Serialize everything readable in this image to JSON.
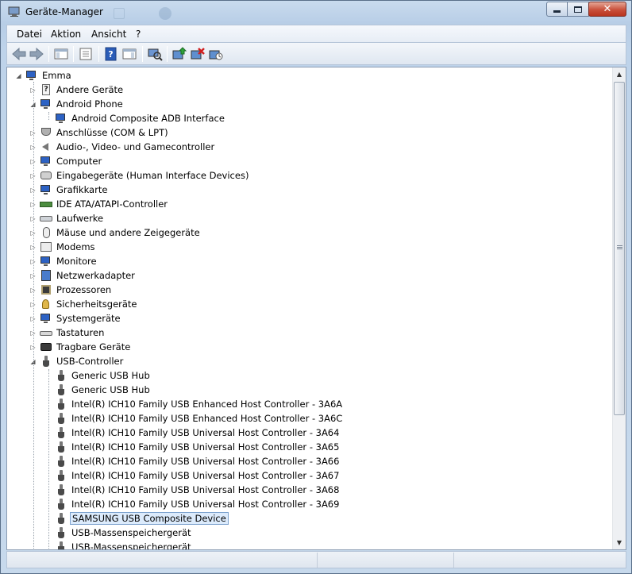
{
  "window": {
    "title": "Geräte-Manager",
    "controls": {
      "minimize": "minimize",
      "maximize": "maximize",
      "close": "✕"
    }
  },
  "menu": [
    "Datei",
    "Aktion",
    "Ansicht",
    "?"
  ],
  "toolbar": {
    "buttons": [
      "back-arrow-icon",
      "forward-arrow-icon",
      "show-hide-console-tree-icon",
      "properties-icon",
      "help-icon",
      "action-pane-icon",
      "scan-hardware-icon",
      "update-driver-icon",
      "uninstall-icon",
      "disable-device-icon"
    ]
  },
  "tree": {
    "root": {
      "label": "Emma",
      "expander": "◢"
    },
    "categories": [
      {
        "label": "Andere Geräte",
        "expander": "▷",
        "icon": "unknown-device-icon"
      },
      {
        "label": "Android Phone",
        "expander": "◢",
        "icon": "phone-icon"
      },
      {
        "label": "Android Composite ADB Interface",
        "icon": "adb-interface-icon"
      },
      {
        "label": "Anschlüsse (COM & LPT)",
        "expander": "▷",
        "icon": "port-icon"
      },
      {
        "label": "Audio-, Video- und Gamecontroller",
        "expander": "▷",
        "icon": "speaker-icon"
      },
      {
        "label": "Computer",
        "expander": "▷",
        "icon": "computer-icon"
      },
      {
        "label": "Eingabegeräte (Human Interface Devices)",
        "expander": "▷",
        "icon": "hid-icon"
      },
      {
        "label": "Grafikkarte",
        "expander": "▷",
        "icon": "display-adapter-icon"
      },
      {
        "label": "IDE ATA/ATAPI-Controller",
        "expander": "▷",
        "icon": "ide-controller-icon"
      },
      {
        "label": "Laufwerke",
        "expander": "▷",
        "icon": "disk-drive-icon"
      },
      {
        "label": "Mäuse und andere Zeigegeräte",
        "expander": "▷",
        "icon": "mouse-icon"
      },
      {
        "label": "Modems",
        "expander": "▷",
        "icon": "modem-icon"
      },
      {
        "label": "Monitore",
        "expander": "▷",
        "icon": "monitor-icon"
      },
      {
        "label": "Netzwerkadapter",
        "expander": "▷",
        "icon": "network-adapter-icon"
      },
      {
        "label": "Prozessoren",
        "expander": "▷",
        "icon": "processor-icon"
      },
      {
        "label": "Sicherheitsgeräte",
        "expander": "▷",
        "icon": "security-key-icon"
      },
      {
        "label": "Systemgeräte",
        "expander": "▷",
        "icon": "system-device-icon"
      },
      {
        "label": "Tastaturen",
        "expander": "▷",
        "icon": "keyboard-icon"
      },
      {
        "label": "Tragbare Geräte",
        "expander": "▷",
        "icon": "portable-device-icon"
      },
      {
        "label": "USB-Controller",
        "expander": "◢",
        "icon": "usb-icon"
      }
    ],
    "usb_children": [
      {
        "label": "Generic USB Hub"
      },
      {
        "label": "Generic USB Hub"
      },
      {
        "label": "Intel(R) ICH10 Family USB Enhanced Host Controller - 3A6A"
      },
      {
        "label": "Intel(R) ICH10 Family USB Enhanced Host Controller - 3A6C"
      },
      {
        "label": "Intel(R) ICH10 Family USB Universal Host Controller - 3A64"
      },
      {
        "label": "Intel(R) ICH10 Family USB Universal Host Controller - 3A65"
      },
      {
        "label": "Intel(R) ICH10 Family USB Universal Host Controller - 3A66"
      },
      {
        "label": "Intel(R) ICH10 Family USB Universal Host Controller - 3A67"
      },
      {
        "label": "Intel(R) ICH10 Family USB Universal Host Controller - 3A68"
      },
      {
        "label": "Intel(R) ICH10 Family USB Universal Host Controller - 3A69"
      },
      {
        "label": "SAMSUNG USB Composite Device",
        "selected": true
      },
      {
        "label": "USB-Massenspeichergerät"
      },
      {
        "label": "USB-Massenspeichergerät"
      }
    ]
  },
  "scrollbar": {
    "up": "▲",
    "down": "▼"
  },
  "statusbar": {
    "text": ""
  }
}
